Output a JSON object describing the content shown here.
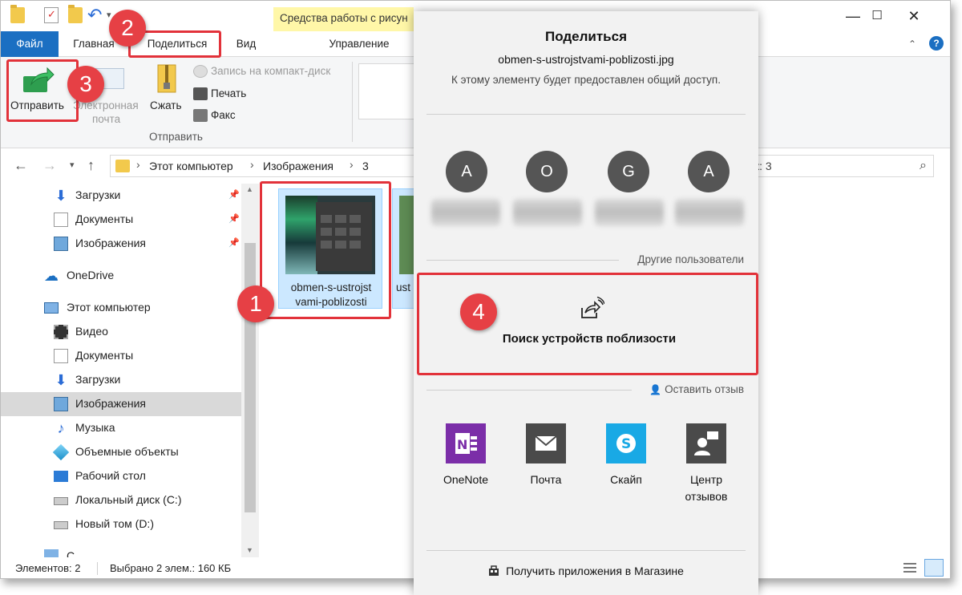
{
  "titlebar": {
    "contextual_tab_title": "Средства работы с рисун"
  },
  "ribbon_tabs": {
    "file": "Файл",
    "home": "Главная",
    "share": "Поделиться",
    "view": "Вид",
    "manage": "Управление"
  },
  "ribbon": {
    "send": "Отправить",
    "email_line1": "Электронная",
    "email_line2": "почта",
    "zip": "Сжать",
    "burn": "Запись на компакт-диск",
    "print": "Печать",
    "fax": "Факс",
    "group_label": "Отправить"
  },
  "address": {
    "crumbs": [
      "Этот компьютер",
      "Изображения",
      "3"
    ],
    "search_text": "ск: 3"
  },
  "nav": {
    "quick": [
      {
        "label": "Загрузки"
      },
      {
        "label": "Документы"
      },
      {
        "label": "Изображения"
      }
    ],
    "onedrive": "OneDrive",
    "this_pc": "Этот компьютер",
    "pc_items": [
      {
        "label": "Видео"
      },
      {
        "label": "Документы"
      },
      {
        "label": "Загрузки"
      },
      {
        "label": "Изображения",
        "selected": true
      },
      {
        "label": "Музыка"
      },
      {
        "label": "Объемные объекты"
      },
      {
        "label": "Рабочий стол"
      },
      {
        "label": "Локальный диск (C:)"
      },
      {
        "label": "Новый том (D:)"
      }
    ],
    "cut_off_item": "С"
  },
  "files": [
    {
      "name_line1": "obmen-s-ustrojst",
      "name_line2": "vami-poblizosti"
    },
    {
      "name_line1": "ust",
      "name_line2": ""
    }
  ],
  "statusbar": {
    "count": "Элементов: 2",
    "selected": "Выбрано 2 элем.: 160 КБ"
  },
  "share": {
    "title": "Поделиться",
    "filename": "obmen-s-ustrojstvami-poblizosti.jpg",
    "description": "К этому элементу будет предоставлен общий доступ.",
    "contacts": [
      {
        "initial": "A"
      },
      {
        "initial": "O"
      },
      {
        "initial": "G"
      },
      {
        "initial": "A"
      }
    ],
    "other_users": "Другие пользователи",
    "nearby_label": "Поиск устройств поблизости",
    "feedback": "Оставить отзыв",
    "apps": [
      {
        "label": "OneNote",
        "color": "#7b2ea8",
        "icon": "onenote-icon"
      },
      {
        "label": "Почта",
        "color": "#4a4a4a",
        "icon": "mail-icon"
      },
      {
        "label": "Скайп",
        "color": "#19a9e5",
        "icon": "skype-icon"
      },
      {
        "label": "Центр отзывов",
        "label_line1": "Центр",
        "label_line2": "отзывов",
        "color": "#4a4a4a",
        "icon": "feedback-hub-icon"
      }
    ],
    "store_link": "Получить приложения в Магазине"
  },
  "annotations": {
    "badges": [
      "1",
      "2",
      "3",
      "4"
    ],
    "color": "#e2323a"
  },
  "colors": {
    "accent": "#1b6fc2",
    "contextual_tab": "#fff7a8",
    "selection": "#cce8ff"
  }
}
